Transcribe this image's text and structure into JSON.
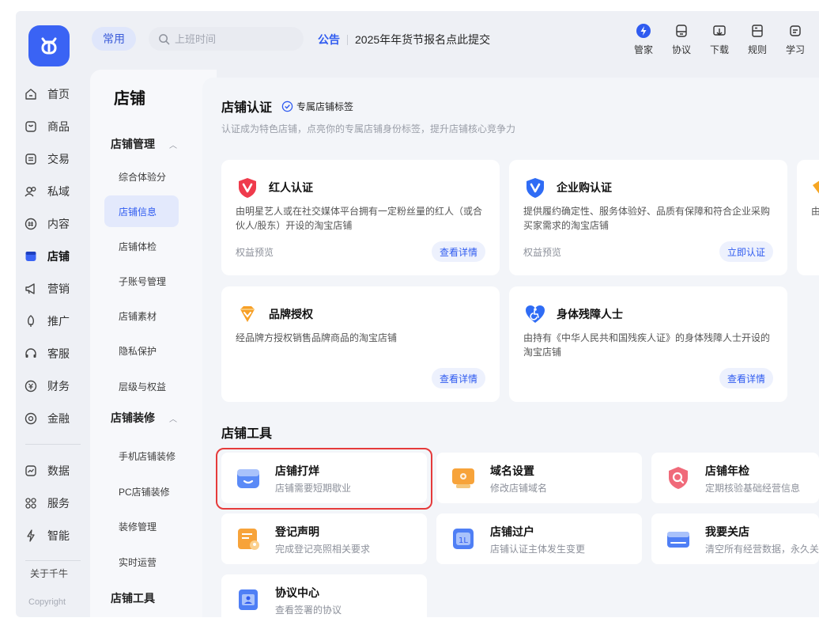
{
  "topbar": {
    "common_label": "常用",
    "search_placeholder": "上班时间",
    "notice_tag": "公告",
    "notice_text": "2025年年货节报名点此提交",
    "tools": [
      {
        "label": "管家",
        "icon": "lightning-badge-icon"
      },
      {
        "label": "协议",
        "icon": "contract-icon"
      },
      {
        "label": "下载",
        "icon": "download-icon"
      },
      {
        "label": "规则",
        "icon": "rules-icon"
      },
      {
        "label": "学习",
        "icon": "learn-icon"
      }
    ]
  },
  "nav": {
    "items": [
      {
        "label": "首页",
        "icon": "home-icon"
      },
      {
        "label": "商品",
        "icon": "goods-icon"
      },
      {
        "label": "交易",
        "icon": "trade-icon"
      },
      {
        "label": "私域",
        "icon": "people-icon"
      },
      {
        "label": "内容",
        "icon": "content-icon"
      },
      {
        "label": "店铺",
        "icon": "shop-icon",
        "active": true
      },
      {
        "label": "营销",
        "icon": "megaphone-icon"
      },
      {
        "label": "推广",
        "icon": "promote-icon"
      },
      {
        "label": "客服",
        "icon": "headset-icon"
      },
      {
        "label": "财务",
        "icon": "finance-icon"
      },
      {
        "label": "金融",
        "icon": "bank-icon"
      },
      {
        "label": "数据",
        "icon": "data-icon"
      },
      {
        "label": "服务",
        "icon": "service-icon"
      },
      {
        "label": "智能",
        "icon": "ai-icon"
      }
    ],
    "about": "关于千牛",
    "copyright": "Copyright"
  },
  "submenu": {
    "title": "店铺",
    "groups": [
      {
        "label": "店铺管理",
        "items": [
          "综合体验分",
          "店铺信息",
          "店铺体检",
          "子账号管理",
          "店铺素材",
          "隐私保护",
          "层级与权益"
        ]
      },
      {
        "label": "店铺装修",
        "items": [
          "手机店铺装修",
          "PC店铺装修",
          "装修管理",
          "实时运营"
        ]
      },
      {
        "label": "店铺工具",
        "items": []
      }
    ],
    "active_item": "店铺信息"
  },
  "certification": {
    "title": "店铺认证",
    "tagline": "专属店铺标签",
    "subtitle": "认证成为特色店铺，点亮你的专属店铺身份标签，提升店铺核心竞争力",
    "cards": [
      {
        "title": "红人认证",
        "desc": "由明星艺人或在社交媒体平台拥有一定粉丝量的红人（或合伙人/股东）开设的淘宝店铺",
        "link": "权益预览",
        "action": "查看详情",
        "icon": "red-v-shield-icon"
      },
      {
        "title": "企业购认证",
        "desc": "提供履约确定性、服务体验好、品质有保障和符合企业采购买家需求的淘宝店铺",
        "link": "权益预览",
        "action": "立即认证",
        "icon": "blue-v-shield-icon"
      },
      {
        "title": "品牌授权",
        "desc": "经品牌方授权销售品牌商品的淘宝店铺",
        "link": "",
        "action": "查看详情",
        "icon": "orange-diamond-icon"
      },
      {
        "title": "身体残障人士",
        "desc": "由持有《中华人民共和国残疾人证》的身体残障人士开设的淘宝店铺",
        "link": "",
        "action": "查看详情",
        "icon": "accessibility-heart-icon"
      },
      {
        "title": "",
        "desc": "由",
        "link": "",
        "action": "",
        "icon": "orange-partial-icon"
      }
    ]
  },
  "shop_tools": {
    "title": "店铺工具",
    "items": [
      {
        "name": "店铺打烊",
        "desc": "店铺需要短期歇业",
        "icon": "shop-closed-icon"
      },
      {
        "name": "域名设置",
        "desc": "修改店铺域名",
        "icon": "domain-icon"
      },
      {
        "name": "店铺年检",
        "desc": "定期核验基础经营信息",
        "icon": "annual-check-icon"
      },
      {
        "name": "登记声明",
        "desc": "完成登记亮照相关要求",
        "icon": "register-icon"
      },
      {
        "name": "店铺过户",
        "desc": "店铺认证主体发生变更",
        "icon": "transfer-icon"
      },
      {
        "name": "我要关店",
        "desc": "清空所有经营数据，永久关闭",
        "icon": "close-shop-icon"
      },
      {
        "name": "协议中心",
        "desc": "查看签署的协议",
        "icon": "agreement-icon"
      }
    ]
  }
}
